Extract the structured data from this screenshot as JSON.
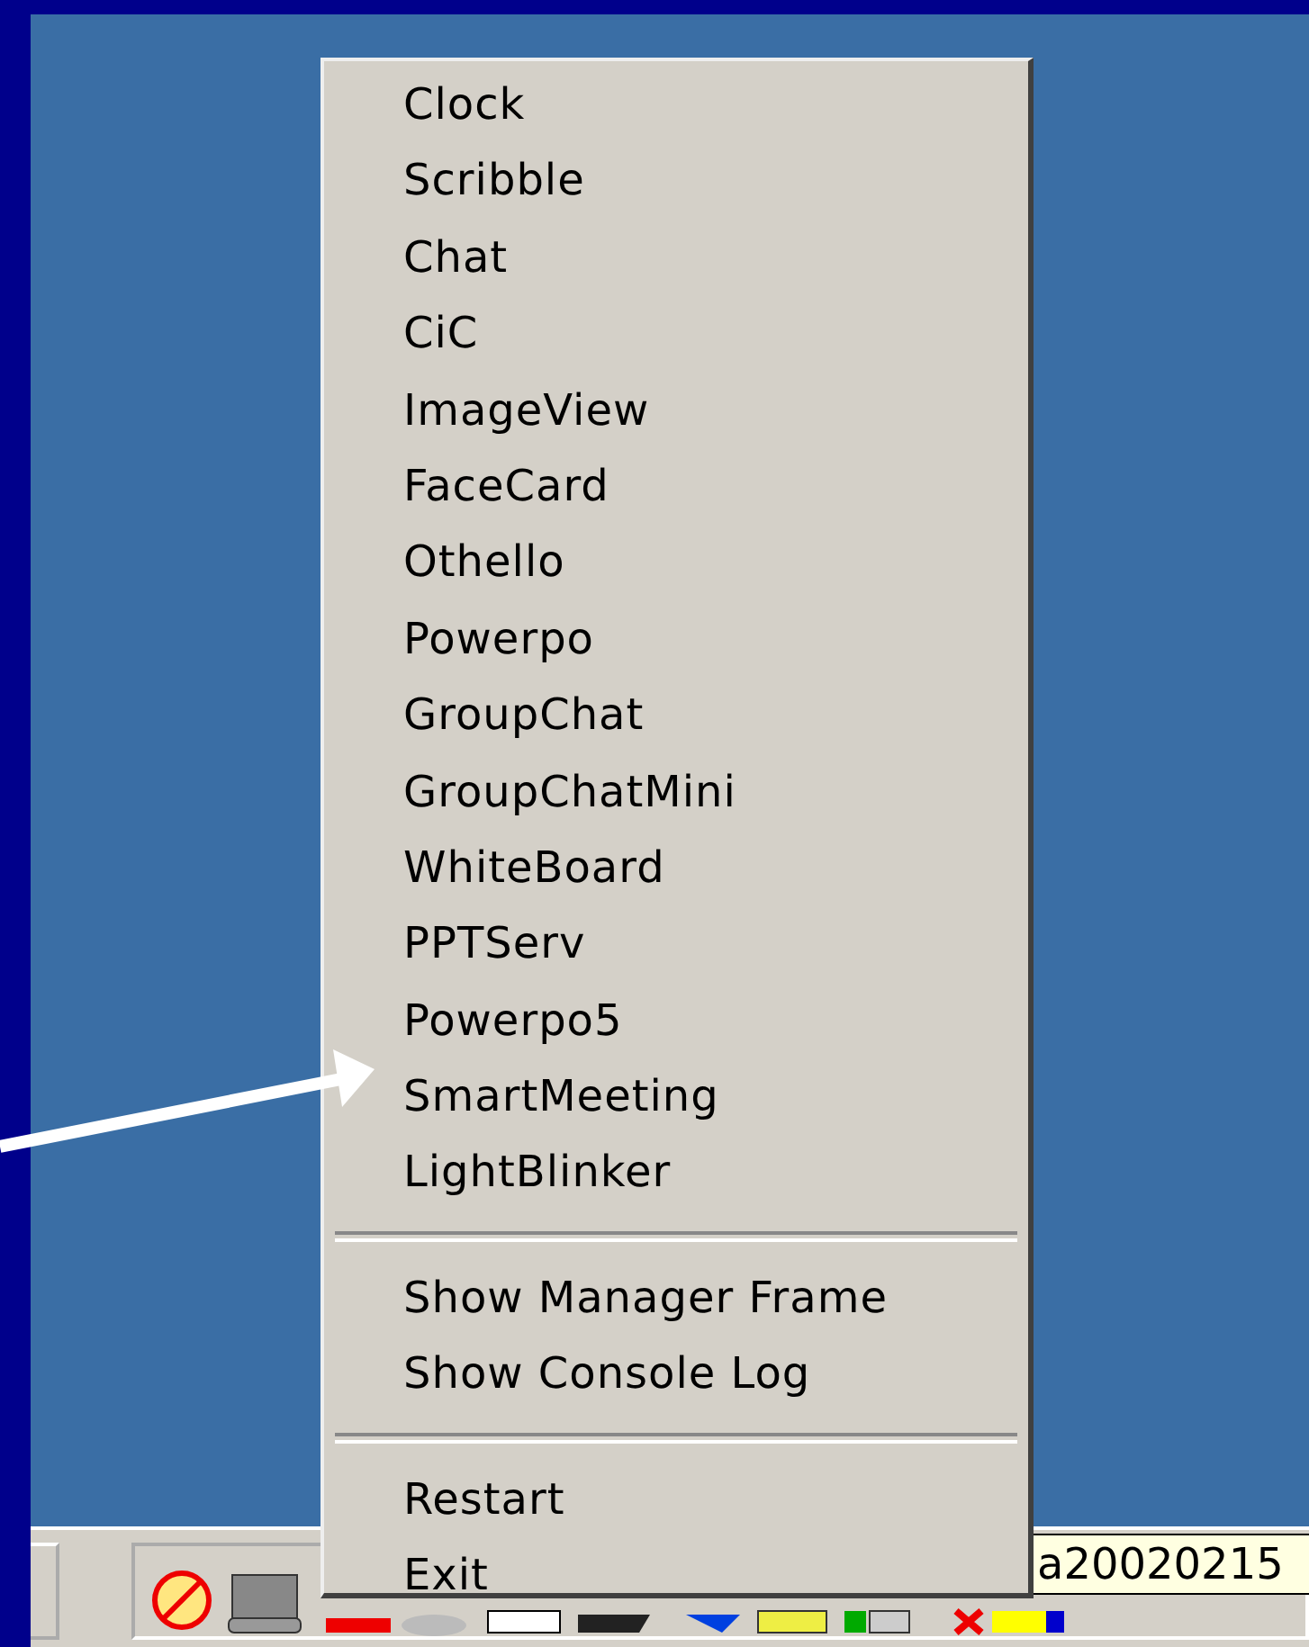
{
  "menu": {
    "groups": [
      {
        "items": [
          "Clock",
          "Scribble",
          "Chat",
          "CiC",
          "ImageView",
          "FaceCard",
          "Othello",
          "Powerpo",
          "GroupChat",
          "GroupChatMini",
          "WhiteBoard",
          "PPTServ",
          "Powerpo5",
          "SmartMeeting",
          "LightBlinker"
        ]
      },
      {
        "items": [
          "Show Manager Frame",
          "Show Console Log"
        ]
      },
      {
        "items": [
          "Restart",
          "Exit"
        ]
      }
    ]
  },
  "tooltip": {
    "text": "a20020215"
  }
}
